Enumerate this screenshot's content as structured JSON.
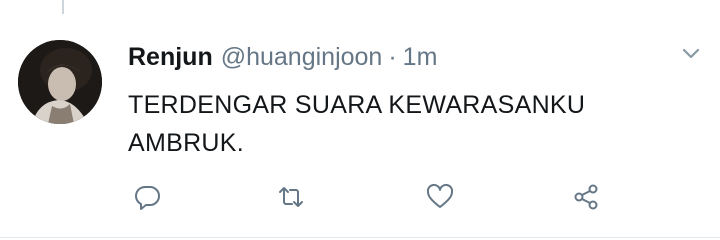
{
  "tweet": {
    "author_name": "Renjun",
    "author_handle": "@huanginjoon",
    "separator": "·",
    "timestamp": "1m",
    "text_lines": [
      "TERDENGAR SUARA KEWARASANKU",
      "AMBRUK."
    ]
  },
  "icons": {
    "caret": "chevron-down-icon",
    "reply": "reply-icon",
    "retweet": "retweet-icon",
    "like": "heart-icon",
    "share": "share-icon"
  },
  "colors": {
    "text_primary": "#14171a",
    "text_secondary": "#657786",
    "icon": "#657786",
    "thread_line": "#cdd6dd",
    "divider": "#e1e8ed"
  }
}
